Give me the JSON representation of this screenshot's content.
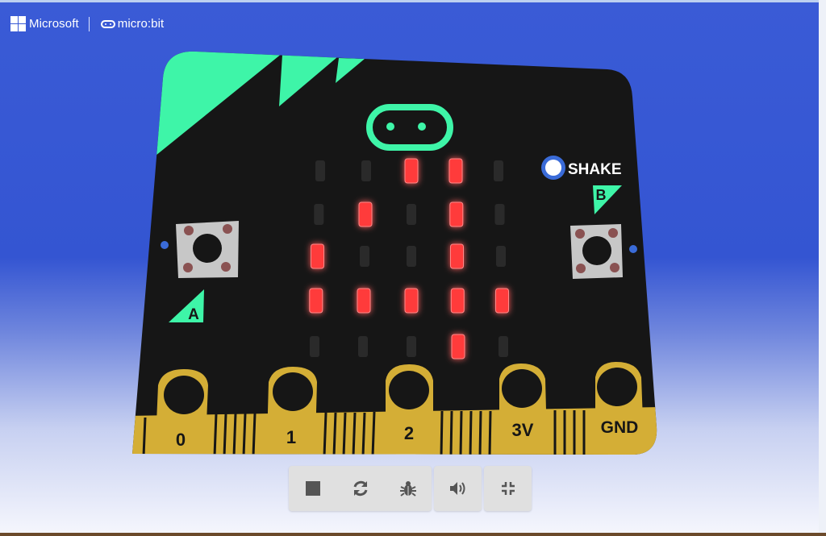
{
  "header": {
    "microsoft_label": "Microsoft",
    "microbit_label": "micro:bit"
  },
  "board": {
    "shake_label": "SHAKE",
    "button_a_label": "A",
    "button_b_label": "B",
    "pins": [
      {
        "label": "0"
      },
      {
        "label": "1"
      },
      {
        "label": "2"
      },
      {
        "label": "3V"
      },
      {
        "label": "GND"
      }
    ],
    "led_matrix": [
      [
        0,
        0,
        1,
        1,
        0
      ],
      [
        0,
        1,
        0,
        1,
        0
      ],
      [
        1,
        0,
        0,
        1,
        0
      ],
      [
        1,
        1,
        1,
        1,
        1
      ],
      [
        0,
        0,
        0,
        1,
        0
      ]
    ],
    "colors": {
      "board": "#161616",
      "accent": "#3ef5a8",
      "pin_gold": "#d4ae36",
      "led_on": "#ff3b3b",
      "led_off": "#2a2a2a",
      "background": "#3455d2"
    }
  },
  "toolbar": {
    "buttons": [
      {
        "icon": "stop-icon"
      },
      {
        "icon": "restart-icon"
      },
      {
        "icon": "debug-bug-icon"
      },
      {
        "icon": "volume-icon"
      },
      {
        "icon": "exit-fullscreen-icon"
      }
    ]
  }
}
